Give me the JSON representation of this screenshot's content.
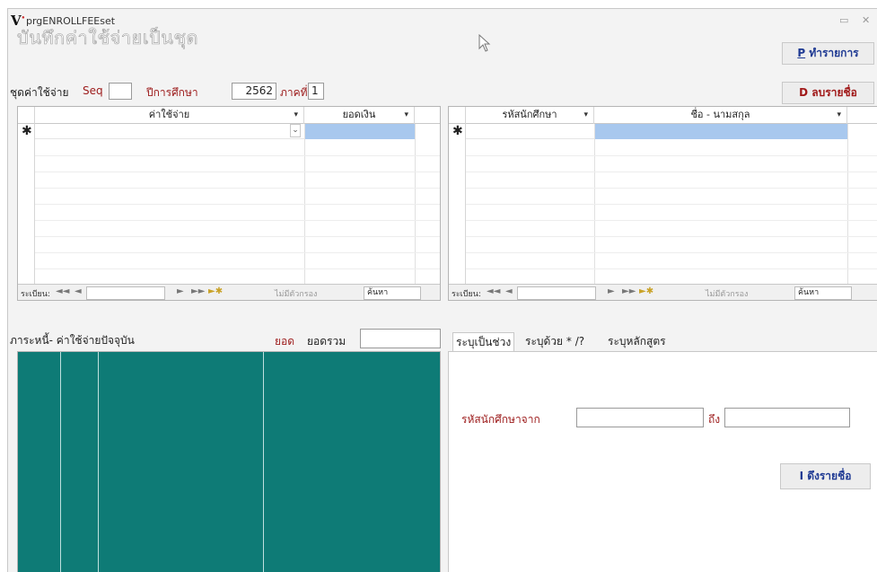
{
  "window": {
    "title": "prgENROLLFEEset",
    "logo": "V",
    "minimize": "▭",
    "close": "✕"
  },
  "form": {
    "title": "บันทึกค่าใช้จ่ายเป็นชุด"
  },
  "buttons": {
    "process_key": "P",
    "process_label": " ทำรายการ",
    "delete_key": "D",
    "delete_label": " ลบรายชื่อ",
    "fetch_key": "I",
    "fetch_label": " ดึงรายชื่อ"
  },
  "header_fields": {
    "fee_set_label": "ชุดค่าใช้จ่าย",
    "seq_label": "Seq",
    "seq_value": "",
    "year_label": "ปีการศึกษา",
    "year_value": "2562",
    "term_label": "ภาคที่",
    "term_value": "1"
  },
  "left_grid": {
    "columns": [
      "ค่าใช้จ่าย",
      "ยอดเงิน"
    ],
    "new_row_marker": "✱",
    "dropdown_glyph": "▾",
    "combo_glyph": "⌄"
  },
  "right_grid": {
    "columns": [
      "รหัสนักศึกษา",
      "ชื่อ - นามสกุล"
    ],
    "new_row_marker": "✱",
    "dropdown_glyph": "▾"
  },
  "navbar": {
    "record_label": "ระเบียน:",
    "first": "◄◄",
    "prev": "◄",
    "next": "►",
    "last": "►►",
    "new": "►✱",
    "filter_label": "ไม่มีตัวกรอง",
    "search_label": "ค้นหา"
  },
  "bottom_left": {
    "title": "ภาระหนี้- ค่าใช้จ่ายปัจจุบัน",
    "amount_label": "ยอด",
    "total_label": "ยอดรวม",
    "total_value": ""
  },
  "tabs": [
    {
      "label": "ระบุเป็นช่วง"
    },
    {
      "label": "ระบุด้วย * /?"
    },
    {
      "label": "ระบุหลักสูตร"
    }
  ],
  "range": {
    "from_label": "รหัสนักศึกษาจาก",
    "from_value": "",
    "to_label": "ถึง",
    "to_value": ""
  },
  "colors": {
    "accent_blue": "#1f3a93",
    "accent_red": "#a01818",
    "teal": "#0e7b76",
    "selection": "#a8c8ee"
  }
}
